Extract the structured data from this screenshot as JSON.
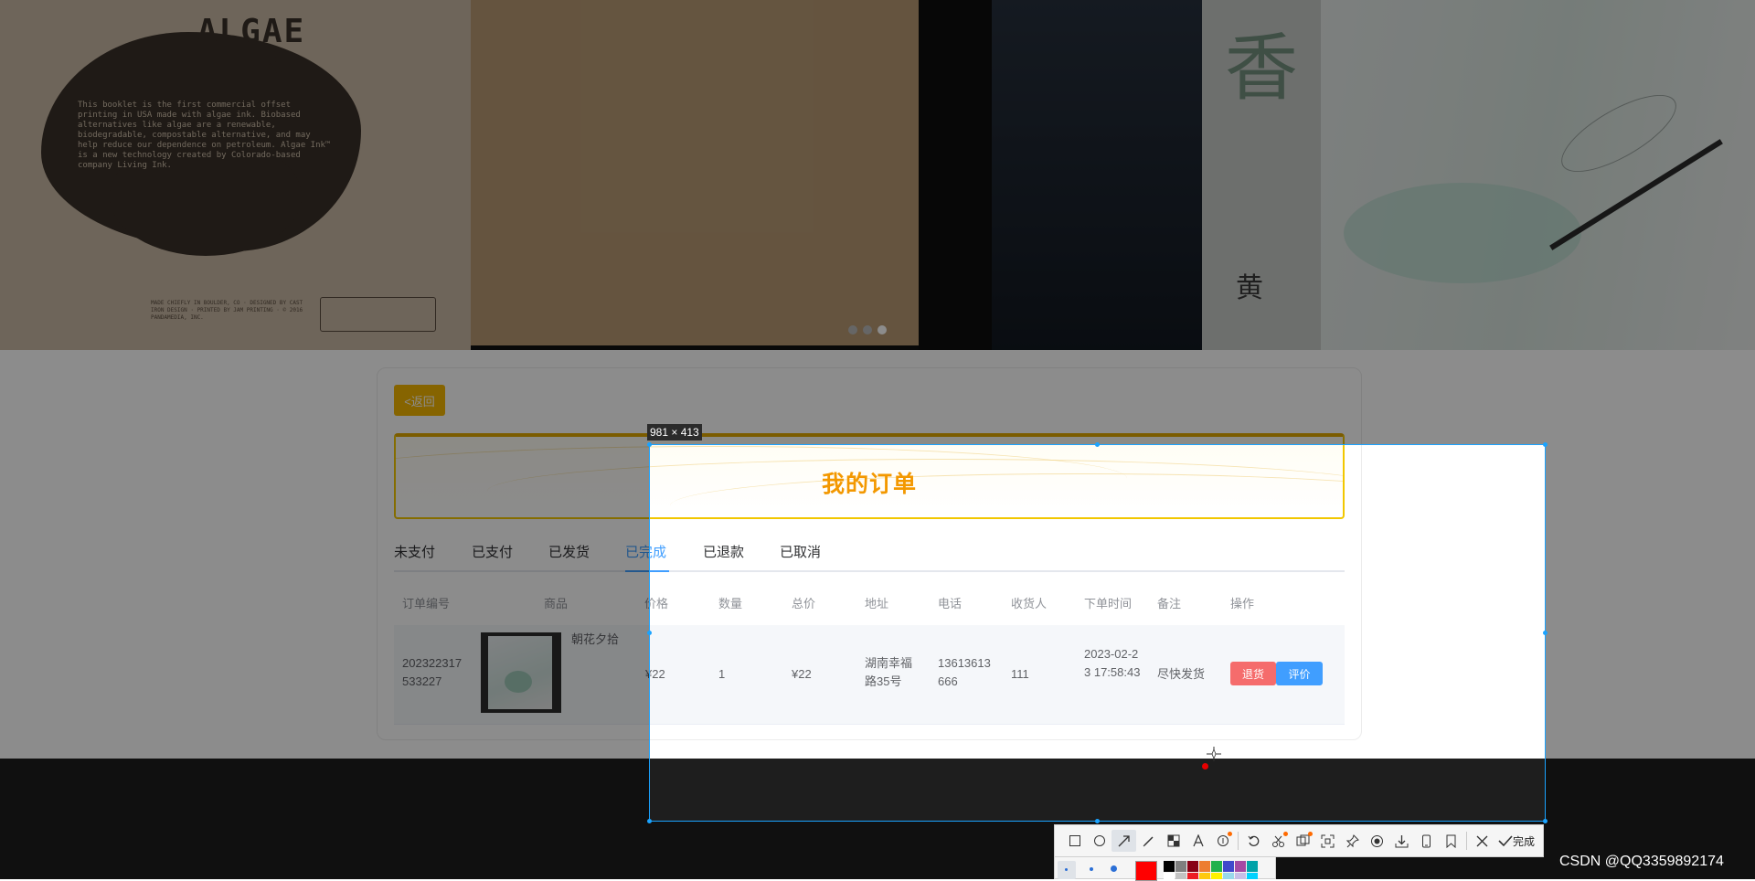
{
  "banner": {
    "algae_title": "ALGAE\nINK",
    "algae_text": "This booklet is the first commercial offset printing in USA made with algae ink. Biobased alternatives like algae are a renewable, biodegradable, compostable alternative, and may help reduce our dependence on petroleum. Algae Ink™ is a new technology created by Colorado-based company Living Ink.",
    "algae_foot": "MADE CHIEFLY IN BOULDER, CO · DESIGNED BY CAST IRON DESIGN · PRINTED BY JAM PRINTING · © 2016 PANDAMEDIA, INC.",
    "callig_main": "香",
    "callig_small": "黄",
    "slide_count": 3,
    "active_slide": 3
  },
  "page": {
    "back_label": "<返回",
    "hero_title": "我的订单",
    "tabs": [
      "未支付",
      "已支付",
      "已发货",
      "已完成",
      "已退款",
      "已取消"
    ],
    "active_tab": "已完成"
  },
  "table": {
    "headers": {
      "order_no": "订单编号",
      "product": "商品",
      "price": "价格",
      "qty": "数量",
      "total": "总价",
      "address": "地址",
      "phone": "电话",
      "receiver": "收货人",
      "time": "下单时间",
      "note": "备注",
      "action": "操作"
    },
    "row": {
      "order_no": "202322317533227",
      "product_name": "朝花夕拾",
      "price": "¥22",
      "qty": "1",
      "total": "¥22",
      "address": "湖南幸福路35号",
      "phone": "13613613666",
      "receiver": "111",
      "time": "2023-02-23 17:58:43",
      "note": "尽快发货",
      "refund_label": "退货",
      "review_label": "评价"
    }
  },
  "overlay": {
    "selection_size": "981 × 413",
    "done_label": "完成",
    "tools": [
      "rect-tool",
      "ellipse-tool",
      "arrow-tool",
      "pen-tool",
      "mosaic-tool",
      "text-tool",
      "serial-tool",
      "undo-tool",
      "ocr-tool",
      "translate-tool",
      "scroll-capture-tool",
      "pin-tool",
      "record-tool",
      "save-tool",
      "phone-tool",
      "bookmark-tool"
    ],
    "current_color": "#ff0000",
    "swatches": [
      "#000000",
      "#7f7f7f",
      "#880015",
      "#ed1c24",
      "#ff7f27",
      "#22b14c",
      "#3f48cc",
      "#a349a4",
      "#00a2e8",
      "#ffffff",
      "#c3c3c3",
      "#b97a57",
      "#ffaec9",
      "#fff200",
      "#99d9ea",
      "#c8bfe7"
    ]
  },
  "watermark": "CSDN @QQ3359892174",
  "colors": {
    "accent": "#409eff",
    "danger": "#f56c6c",
    "brand": "#f39800",
    "back": "#f5b700"
  }
}
